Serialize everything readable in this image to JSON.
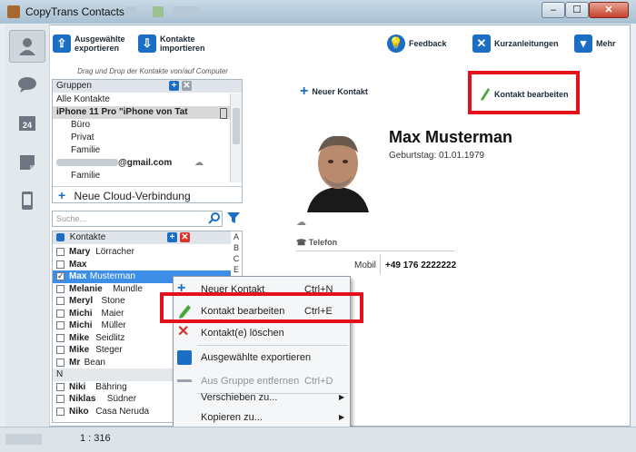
{
  "window": {
    "title": "CopyTrans Contacts"
  },
  "toolbar": {
    "export_label_1": "Ausgewählte",
    "export_label_2": "exportieren",
    "import_label_1": "Kontakte",
    "import_label_2": "importieren",
    "feedback_label": "Feedback",
    "guides_label": "Kurzanleitungen",
    "more_label": "Mehr"
  },
  "groups": {
    "dragdrop_hint": "Drag und Drop der Kontakte von/auf Computer",
    "header": "Gruppen",
    "items": [
      {
        "label": "Alle Kontakte"
      },
      {
        "label": "iPhone 11 Pro \"iPhone von Tat"
      },
      {
        "label": "Büro"
      },
      {
        "label": "Privat"
      },
      {
        "label": "Familie"
      },
      {
        "label": "@gmail.com"
      },
      {
        "label": "Familie"
      }
    ],
    "new_cloud_label": "Neue Cloud-Verbindung"
  },
  "search": {
    "placeholder": "Suche..."
  },
  "contacts": {
    "header": "Kontakte",
    "alphabet": [
      "A",
      "B",
      "C",
      "E"
    ],
    "items": [
      {
        "first": "Mary",
        "last": "Lörracher",
        "checked": false
      },
      {
        "first": "Max",
        "last": "",
        "checked": false
      },
      {
        "first": "Max",
        "last": "Musterman",
        "checked": true,
        "selected": true
      },
      {
        "first": "Melanie",
        "last": "Mundle",
        "checked": false
      },
      {
        "first": "Meryl",
        "last": "Stone",
        "checked": false
      },
      {
        "first": "Michi",
        "last": "Maier",
        "checked": false
      },
      {
        "first": "Michi",
        "last": "Müller",
        "checked": false
      },
      {
        "first": "Mike",
        "last": "Seidlitz",
        "checked": false
      },
      {
        "first": "Mike",
        "last": "Steger",
        "checked": false
      },
      {
        "first": "Mr",
        "last": "Bean",
        "checked": false
      },
      {
        "section": "N"
      },
      {
        "first": "Niki",
        "last": "Bähring",
        "checked": false
      },
      {
        "first": "Niklas",
        "last": "Südner",
        "checked": false
      },
      {
        "first": "Niko",
        "last": "Casa Neruda",
        "checked": false
      }
    ]
  },
  "detail": {
    "new_contact_label": "Neuer Kontakt",
    "edit_contact_label": "Kontakt bearbeiten",
    "name": "Max Musterman",
    "birthday": "Geburtstag: 01.01.1979",
    "phone_section": "Telefon",
    "phone_type": "Mobil",
    "phone_number": "+49 176 2222222"
  },
  "context_menu": {
    "items": [
      {
        "label": "Neuer Kontakt",
        "shortcut": "Ctrl+N"
      },
      {
        "label": "Kontakt bearbeiten",
        "shortcut": "Ctrl+E"
      },
      {
        "label": "Kontakt(e) löschen",
        "shortcut": ""
      },
      {
        "label": "Ausgewählte exportieren",
        "shortcut": ""
      },
      {
        "label": "Aus Gruppe entfernen",
        "shortcut": "Ctrl+D"
      },
      {
        "label": "Verschieben zu...",
        "shortcut": ""
      },
      {
        "label": "Kopieren zu...",
        "shortcut": ""
      }
    ]
  },
  "status": {
    "count": "1 : 316"
  },
  "colors": {
    "highlight": "#e4101c",
    "accent_blue": "#1a6fc4",
    "selection": "#3d8ee6"
  }
}
